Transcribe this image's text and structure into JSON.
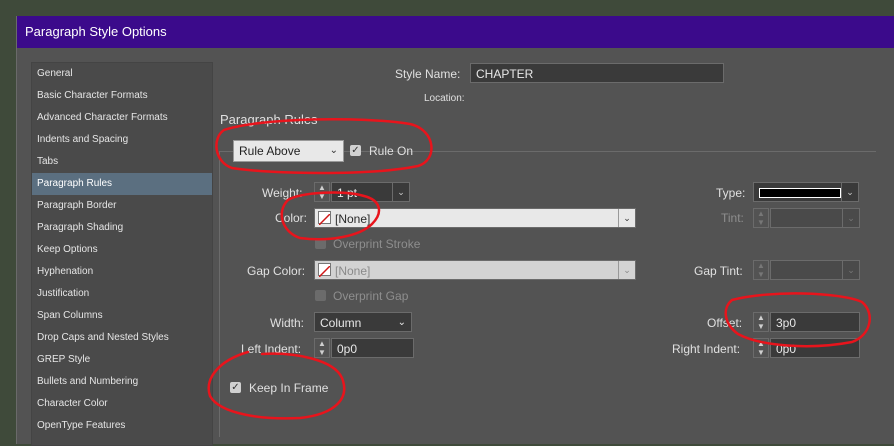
{
  "dialog": {
    "title": "Paragraph Style Options"
  },
  "sidebar": {
    "items": [
      {
        "label": "General"
      },
      {
        "label": "Basic Character Formats"
      },
      {
        "label": "Advanced Character Formats"
      },
      {
        "label": "Indents and Spacing"
      },
      {
        "label": "Tabs"
      },
      {
        "label": "Paragraph Rules",
        "selected": true
      },
      {
        "label": "Paragraph Border"
      },
      {
        "label": "Paragraph Shading"
      },
      {
        "label": "Keep Options"
      },
      {
        "label": "Hyphenation"
      },
      {
        "label": "Justification"
      },
      {
        "label": "Span Columns"
      },
      {
        "label": "Drop Caps and Nested Styles"
      },
      {
        "label": "GREP Style"
      },
      {
        "label": "Bullets and Numbering"
      },
      {
        "label": "Character Color"
      },
      {
        "label": "OpenType Features"
      }
    ]
  },
  "header": {
    "style_name_label": "Style Name:",
    "style_name_value": "CHAPTER",
    "location_label": "Location:",
    "section_title": "Paragraph Rules"
  },
  "rules": {
    "rule_select": "Rule Above",
    "rule_on_label": "Rule On",
    "rule_on_checked": true,
    "weight_label": "Weight:",
    "weight_value": "1 pt",
    "type_label": "Type:",
    "color_label": "Color:",
    "color_value": "[None]",
    "tint_label": "Tint:",
    "overprint_stroke_label": "Overprint Stroke",
    "gap_color_label": "Gap Color:",
    "gap_color_value": "[None]",
    "gap_tint_label": "Gap Tint:",
    "overprint_gap_label": "Overprint Gap",
    "width_label": "Width:",
    "width_value": "Column",
    "offset_label": "Offset:",
    "offset_value": "3p0",
    "left_indent_label": "Left Indent:",
    "left_indent_value": "0p0",
    "right_indent_label": "Right Indent:",
    "right_indent_value": "0p0",
    "keep_in_frame_label": "Keep In Frame",
    "keep_in_frame_checked": true
  },
  "colors": {
    "title_bar": "#3b0a8b",
    "annotation": "#e8141c",
    "selected_item": "#5b6f80"
  }
}
